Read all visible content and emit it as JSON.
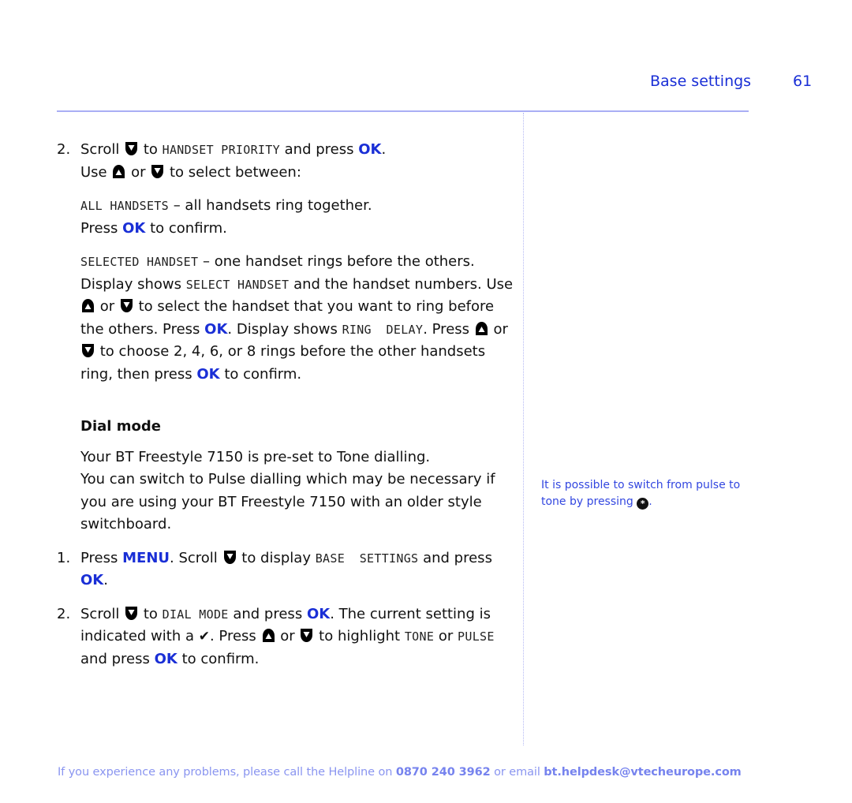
{
  "header": {
    "section_title": "Base settings",
    "page_number": "61"
  },
  "colors": {
    "accent_blue": "#1a2fd6",
    "rule": "#a9aef4",
    "footer": "#8a95f0",
    "sidenote": "#3347e0"
  },
  "icons": {
    "scroll_down": "down-arrow-button-icon",
    "scroll_up": "up-arrow-button-icon",
    "star_key": "star-key-icon",
    "check": "check-mark-icon"
  },
  "step_handset_priority": {
    "number": "2.",
    "t1": "Scroll",
    "t2": "to",
    "lcd1": "HANDSET PRIORITY",
    "t3": "and press",
    "ok": "OK",
    "t4": ".",
    "t5": "Use",
    "t6": "or",
    "t7": "to select between:"
  },
  "option_all": {
    "lcd": "ALL HANDSETS",
    "t1": " – all handsets ring together.",
    "t2": "Press",
    "ok": "OK",
    "t3": "to confirm."
  },
  "option_selected": {
    "lcd1": "SELECTED HANDSET",
    "t1": " – one handset rings before the others. Display shows ",
    "lcd2": "SELECT HANDSET",
    "t2": " and the handset numbers. Use",
    "t3": "or",
    "t4": "to select the handset that you want to ring before the others. Press",
    "ok1": "OK",
    "t5": ". Display shows",
    "lcd3": "RING  DELAY",
    "t6": ". Press",
    "t7": "or",
    "t8": "to choose 2, 4, 6, or 8 rings before the other handsets ring, then press",
    "ok2": "OK",
    "t9": "to confirm."
  },
  "dial_mode": {
    "heading": "Dial mode",
    "intro1": "Your BT Freestyle 7150 is pre-set to Tone dialling.",
    "intro2": "You can switch to Pulse dialling which may be necessary if you are using your BT Freestyle 7150 with an older style switchboard.",
    "step1": {
      "number": "1.",
      "t1": "Press",
      "menu": "MENU",
      "t2": ". Scroll",
      "t3": "to display",
      "lcd": "BASE  SETTINGS",
      "t4": "and press",
      "ok": "OK",
      "t5": "."
    },
    "step2": {
      "number": "2.",
      "t1": "Scroll",
      "t2": "to",
      "lcd1": "DIAL MODE",
      "t3": "and press",
      "ok1": "OK",
      "t4": ". The current setting is indicated with a",
      "check": "✔",
      "t5": ". Press",
      "t6": "or",
      "t7": "to highlight",
      "lcd2": "TONE",
      "t8": "or",
      "lcd3": "PULSE",
      "t9": "and press",
      "ok2": "OK",
      "t10": "to confirm."
    }
  },
  "sidenote": {
    "t1": "It is possible to switch from pulse to tone by pressing",
    "star": "*",
    "t2": "."
  },
  "footer": {
    "t1": "If you experience any problems, please call the Helpline on",
    "phone": "0870 240 3962",
    "t2": "or email",
    "email": "bt.helpdesk@vtecheurope.com"
  }
}
